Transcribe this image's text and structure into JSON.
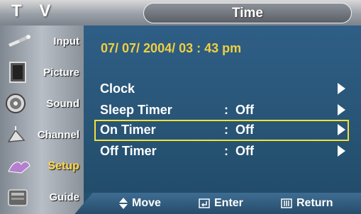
{
  "header": {
    "tv_label": "T V",
    "menu_title": "Time"
  },
  "sidebar": {
    "items": [
      {
        "label": "Input",
        "icon": "input-icon"
      },
      {
        "label": "Picture",
        "icon": "picture-icon"
      },
      {
        "label": "Sound",
        "icon": "sound-icon"
      },
      {
        "label": "Channel",
        "icon": "channel-icon"
      },
      {
        "label": "Setup",
        "icon": "setup-icon",
        "active": true
      },
      {
        "label": "Guide",
        "icon": "guide-icon"
      }
    ]
  },
  "main": {
    "datetime": "07/ 07/ 2004/ 03 : 43  pm",
    "rows": [
      {
        "name": "Clock",
        "value": ""
      },
      {
        "name": "Sleep Timer",
        "value": ":  Off"
      },
      {
        "name": "On Timer",
        "value": ":  Off",
        "selected": true
      },
      {
        "name": "Off Timer",
        "value": ":  Off"
      }
    ]
  },
  "footer": {
    "move": "Move",
    "enter": "Enter",
    "return": "Return",
    "move_icon": "updown-arrow-icon",
    "enter_icon": "enter-icon",
    "return_icon": "menu-icon"
  },
  "colors": {
    "accent_yellow": "#f0d040",
    "highlight_border": "#f2e03a",
    "panel_blue": "#2f5e86"
  }
}
